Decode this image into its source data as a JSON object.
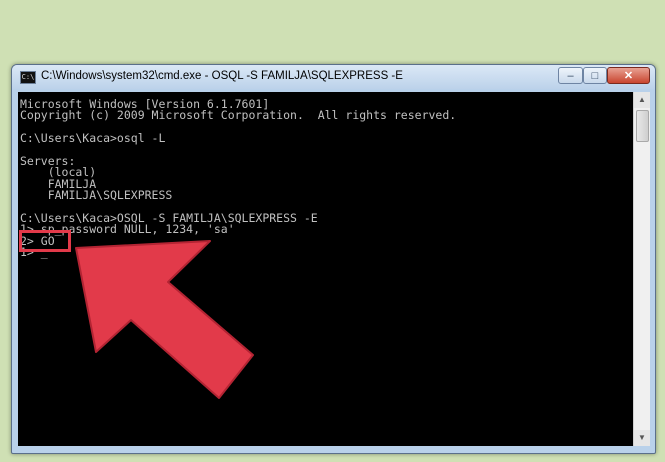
{
  "window": {
    "title": "C:\\Windows\\system32\\cmd.exe - OSQL  -S FAMILJA\\SQLEXPRESS -E",
    "icon_text": "C:\\",
    "controls": {
      "minimize": "–",
      "maximize": "□",
      "close": "✕"
    }
  },
  "console": {
    "lines": [
      "Microsoft Windows [Version 6.1.7601]",
      "Copyright (c) 2009 Microsoft Corporation.  All rights reserved.",
      "",
      "C:\\Users\\Kaca>osql -L",
      "",
      "Servers:",
      "    (local)",
      "    FAMILJA",
      "    FAMILJA\\SQLEXPRESS",
      "",
      "C:\\Users\\Kaca>OSQL -S FAMILJA\\SQLEXPRESS -E",
      "1> sp_password NULL, 1234, 'sa'",
      "2> GO",
      "1> _"
    ]
  },
  "annotation": {
    "arrow_color": "#e23a4a",
    "box_color": "#e23a4a"
  },
  "colors": {
    "background": "#cfe0b4",
    "console_bg": "#000000",
    "console_text": "#c0c0c0"
  }
}
